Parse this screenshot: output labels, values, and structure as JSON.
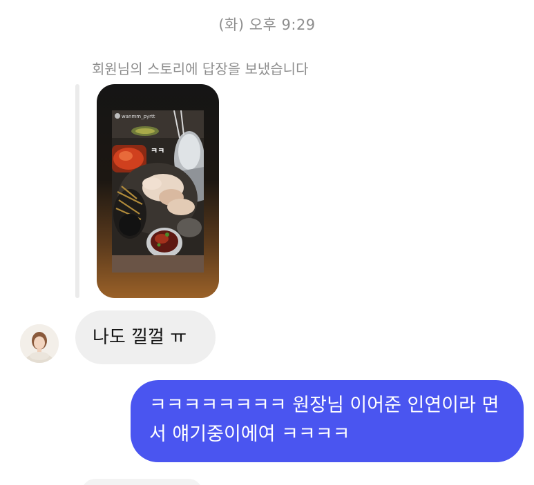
{
  "thread": {
    "timestamp": "(화) 오후 9:29",
    "story_reply_note": "회원님의 스토리에 답장을 보냈습니다"
  },
  "story": {
    "username": "wanmm_pyrtt",
    "sticker_text": "ㅋㅋ",
    "icon": "story-photo-thumbnail"
  },
  "messages": [
    {
      "direction": "incoming",
      "text": "나도 낄껄 ㅠ"
    },
    {
      "direction": "outgoing",
      "text": "ㅋㅋㅋㅋㅋㅋㅋㅋ 원장님 이어준 인연이라 면서 얘기중이에여 ㅋㅋㅋㅋ"
    }
  ],
  "colors": {
    "outgoing_bubble": "#4a55f0",
    "incoming_bubble": "#efefef",
    "meta_text": "#8e8e8e"
  }
}
